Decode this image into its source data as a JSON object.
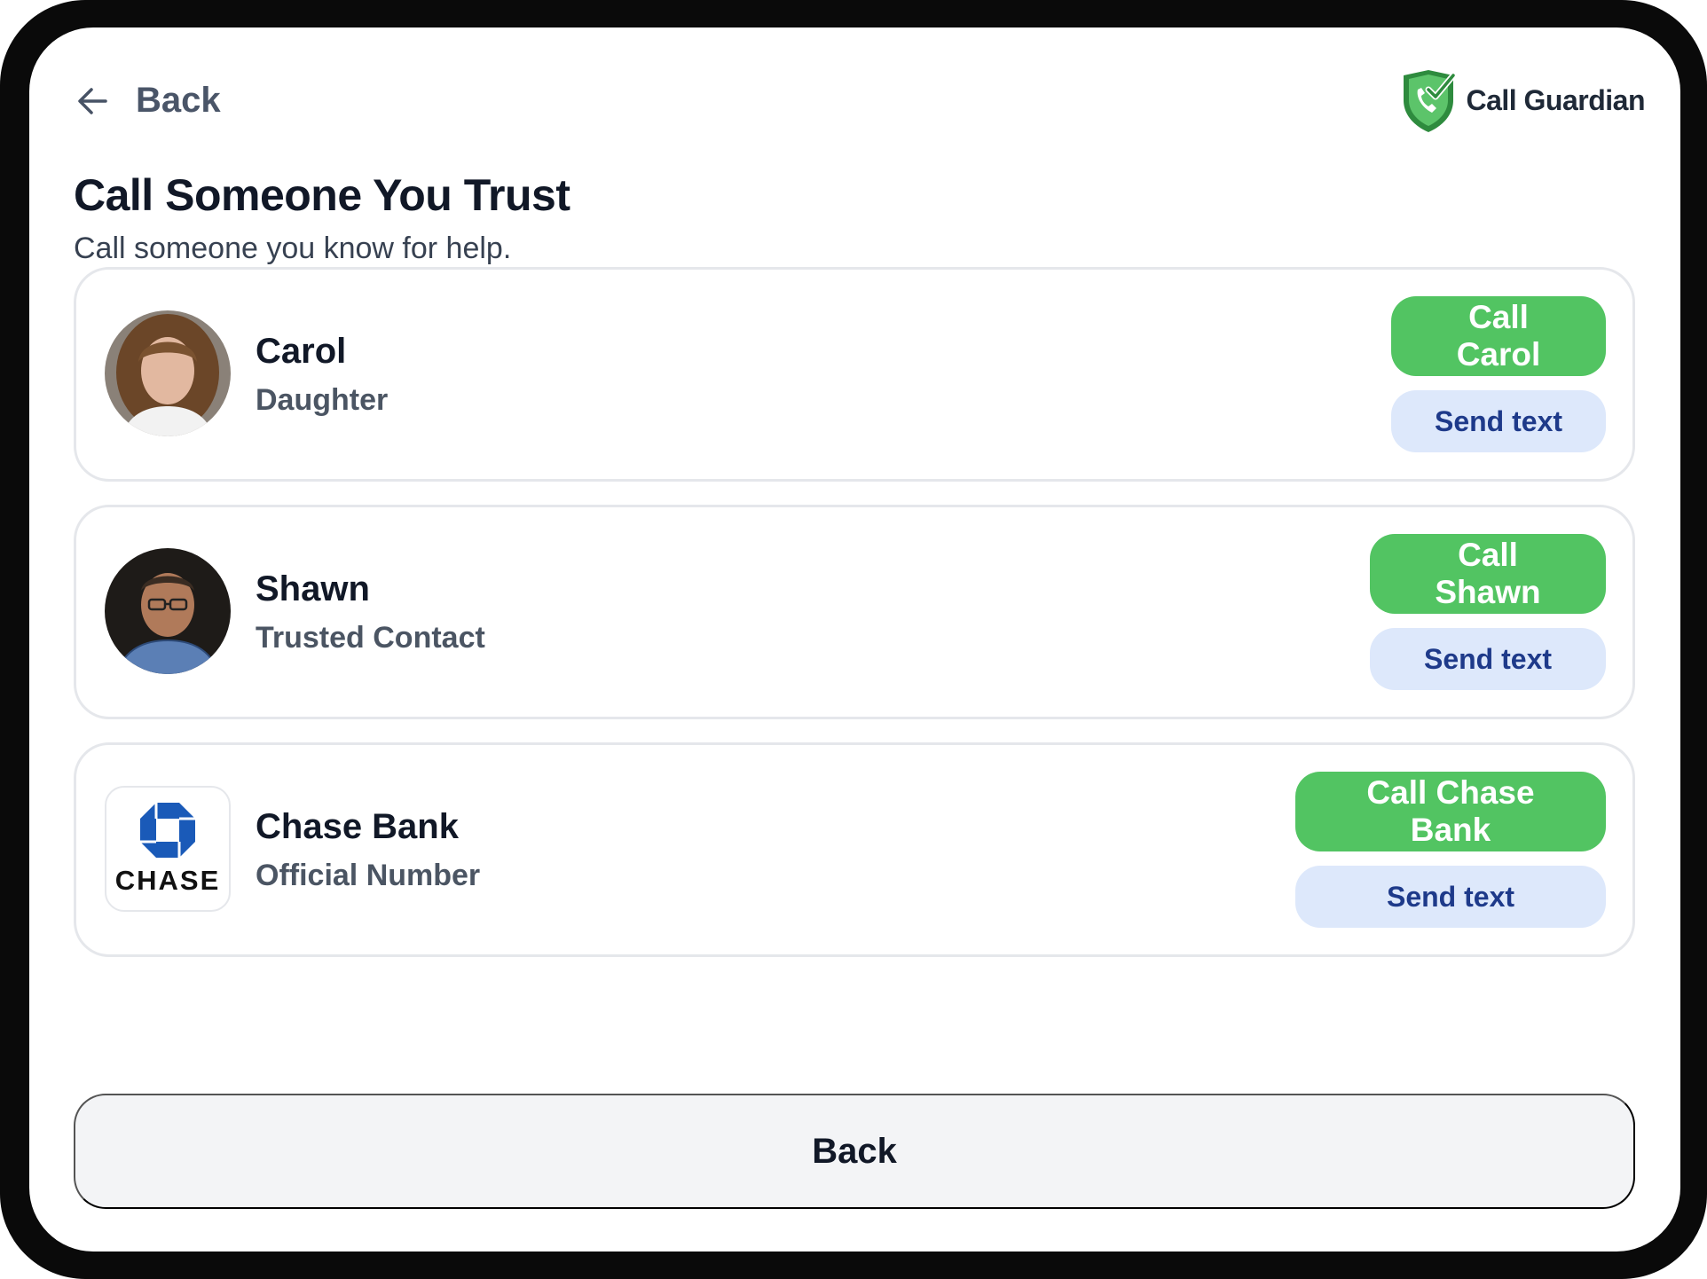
{
  "header": {
    "back_label": "Back",
    "brand_name": "Call Guardian",
    "brand_icon": "shield-check-phone-icon"
  },
  "page": {
    "title": "Call Someone You Trust",
    "subtitle": "Call someone you know for help."
  },
  "contacts": [
    {
      "name": "Carol",
      "role": "Daughter",
      "avatar": "photo-avatar",
      "call_label": "Call Carol",
      "text_label": "Send text"
    },
    {
      "name": "Shawn",
      "role": "Trusted Contact",
      "avatar": "photo-avatar",
      "call_label": "Call Shawn",
      "text_label": "Send text"
    },
    {
      "name": "Chase Bank",
      "role": "Official Number",
      "logo_text": "CHASE",
      "call_label": "Call Chase Bank",
      "text_label": "Send text"
    }
  ],
  "footer": {
    "back_label": "Back"
  },
  "colors": {
    "call_button": "#52c462",
    "text_button_bg": "#dde8fb",
    "text_button_fg": "#1e3a8a",
    "chase_blue": "#1a5ab8"
  }
}
